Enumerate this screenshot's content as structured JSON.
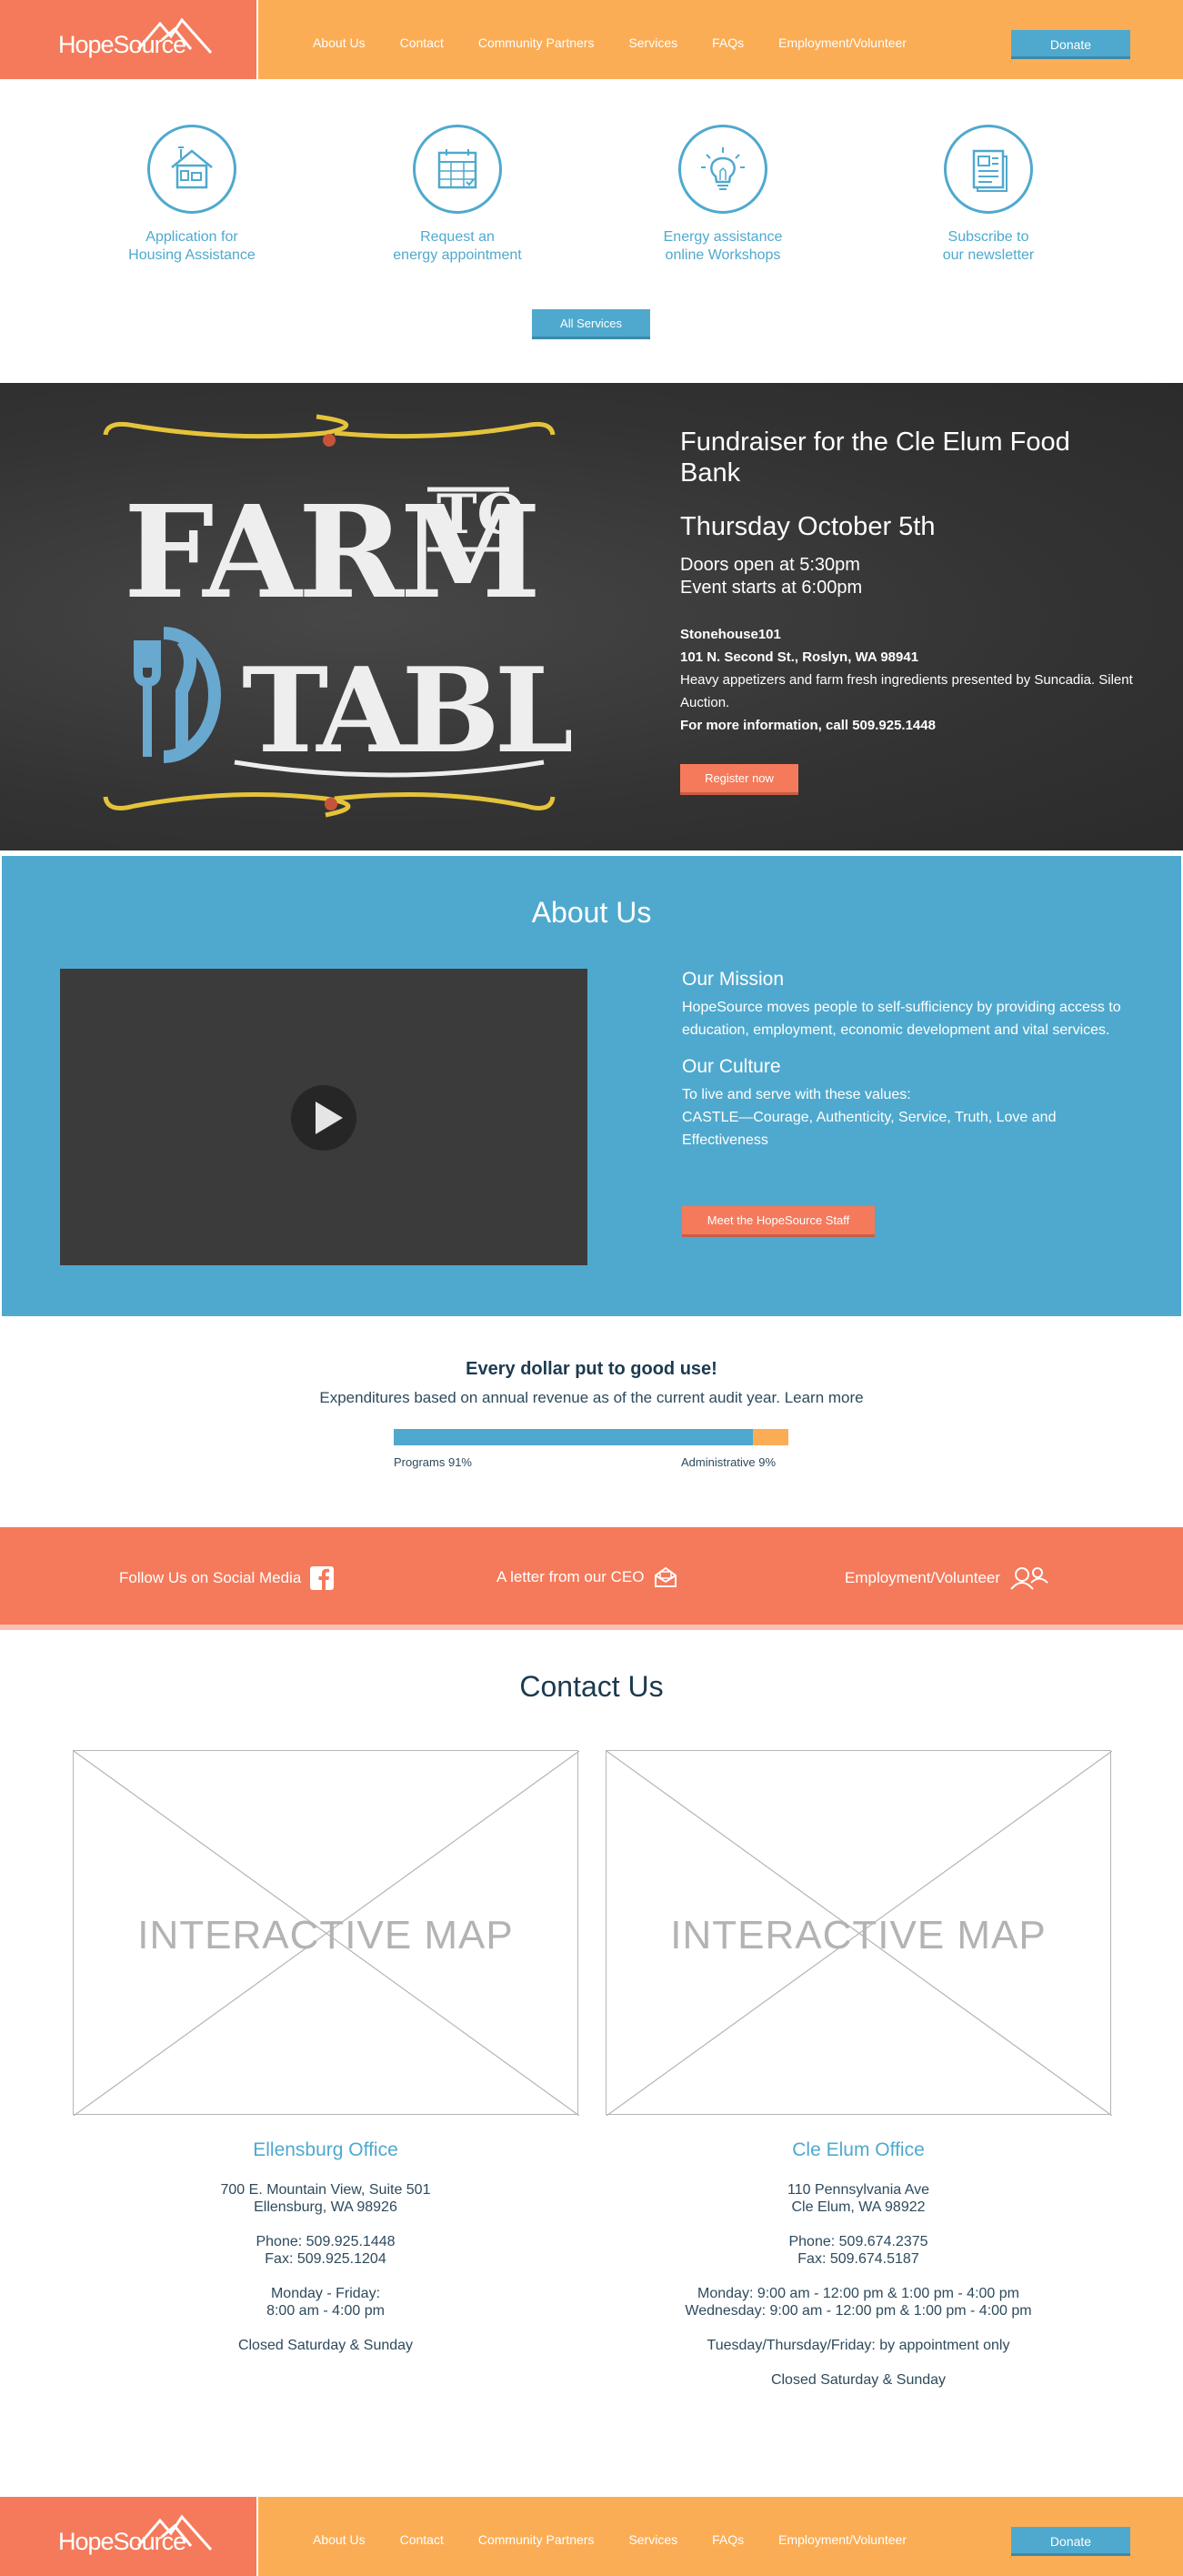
{
  "header": {
    "logo": "HopeSource",
    "nav": [
      "About Us",
      "Contact",
      "Community Partners",
      "Services",
      "FAQs",
      "Employment/Volunteer"
    ],
    "donate": "Donate"
  },
  "services": {
    "items": [
      {
        "label": "Application for\nHousing Assistance",
        "icon": "house-icon"
      },
      {
        "label": "Request an\nenergy appointment",
        "icon": "calendar-icon"
      },
      {
        "label": "Energy assistance\nonline Workshops",
        "icon": "lightbulb-icon"
      },
      {
        "label": "Subscribe to\nour newsletter",
        "icon": "newsletter-icon"
      }
    ],
    "all_button": "All Services"
  },
  "event": {
    "art_words": {
      "farm": "FARM",
      "to": "TO",
      "table": "TABLE"
    },
    "title": "Fundraiser for the Cle Elum Food Bank",
    "date": "Thursday October 5th",
    "doors": "Doors open at 5:30pm",
    "start": "Event starts at 6:00pm",
    "venue": "Stonehouse101",
    "address": "101 N. Second St., Roslyn, WA 98941",
    "description": "Heavy appetizers and farm fresh ingredients presented by Suncadia. Silent Auction.",
    "info": "For more information, call 509.925.1448",
    "register": "Register now"
  },
  "about": {
    "heading": "About Us",
    "mission_title": "Our Mission",
    "mission_text": "HopeSource moves people to self-sufficiency by providing access to education, employment, economic development and vital services.",
    "culture_title": "Our Culture",
    "culture_line1": "To live and serve with these values:",
    "culture_line2": "CASTLE—Courage, Authenticity, Service, Truth, Love and Effectiveness",
    "staff_button": "Meet the HopeSource Staff"
  },
  "expenditures": {
    "heading": "Every dollar put to good use!",
    "subtitle": "Expenditures based on annual revenue as of the current audit year.",
    "learn_more": "Learn more",
    "programs_label": "Programs 91%",
    "admin_label": "Administrative 9%",
    "programs_fraction": 0.91,
    "admin_fraction": 0.09
  },
  "social": {
    "follow": "Follow Us on Social Media",
    "ceo_letter": "A letter from our CEO",
    "employment": "Employment/Volunteer"
  },
  "contact": {
    "heading": "Contact Us",
    "map_label": "INTERACTIVE MAP",
    "offices": [
      {
        "name": "Ellensburg Office",
        "address1": "700 E. Mountain View, Suite 501",
        "address2": "Ellensburg, WA 98926",
        "phone": "Phone: 509.925.1448",
        "fax": "Fax: 509.925.1204",
        "hours1": "Monday - Friday:",
        "hours2": "8:00 am - 4:00 pm",
        "closed": "Closed Saturday & Sunday"
      },
      {
        "name": "Cle Elum Office",
        "address1": "110 Pennsylvania Ave",
        "address2": "Cle Elum, WA 98922",
        "phone": "Phone: 509.674.2375",
        "fax": "Fax: 509.674.5187",
        "hours1": "Monday: 9:00 am - 12:00 pm & 1:00 pm - 4:00 pm",
        "hours2": "Wednesday: 9:00 am - 12:00 pm & 1:00 pm - 4:00 pm",
        "appointment": "Tuesday/Thursday/Friday: by appointment only",
        "closed": "Closed Saturday & Sunday"
      }
    ]
  },
  "colors": {
    "coral": "#f47a5b",
    "orange": "#fbad55",
    "blue": "#4fa9ce",
    "navy": "#1c3a4f"
  }
}
